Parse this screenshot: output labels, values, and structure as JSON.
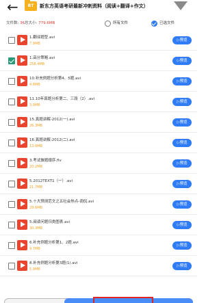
{
  "header": {
    "back_glyph": "←",
    "folder_badge": "BT",
    "title": "新东方英语考研最新冲刺资料（阅读+翻译+作文）"
  },
  "info": {
    "count_label": "文件数:",
    "count": "36",
    "size_label": "总大小:",
    "size": "779.6MB",
    "option_all": "所有文件",
    "option_selected": "已选文件"
  },
  "files": [
    {
      "name": "1.翻译题型.avi",
      "size": "7.9MB",
      "checked": false
    },
    {
      "name": "1.高分策略.avi",
      "size": "258.4MB",
      "checked": true
    },
    {
      "name": "10.补充例题分析第4、5题.avi",
      "size": "4.8MB",
      "checked": false
    },
    {
      "name": "11.10年真题分析第二、三段（2）.avi",
      "size": "3.0MB",
      "checked": false
    },
    {
      "name": "15.真题讲解-2012(一).avi",
      "size": "26.3MB",
      "checked": false
    },
    {
      "name": "16.真题讲解-2012(二).avi",
      "size": "13.6MB",
      "checked": false
    },
    {
      "name": "3.考试做题顺序.flv",
      "size": "20.2MB",
      "checked": false
    },
    {
      "name": "5.2012TEXT1（一）.avi",
      "size": "21.7MB",
      "checked": false
    },
    {
      "name": "5.十大预测范文之五社会热点-调侃.avi",
      "size": "29.6MB",
      "checked": false
    },
    {
      "name": "5.阅读问题归类图表.avi",
      "size": "30.3MB",
      "checked": false
    },
    {
      "name": "6.补充例题分析第1、2题.avi",
      "size": "9.7MB",
      "checked": false
    },
    {
      "name": "8.补充例题分析第3题(1).avi",
      "size": "5.9MB",
      "checked": false
    }
  ],
  "preview_label": "预览",
  "preview_glyph": "▷",
  "colors": {
    "accent": "#2f7cf6",
    "checked": "#2c9a7a",
    "video_icon": "#e8442e",
    "size_text": "#f0a020",
    "count_text": "#e53935",
    "highlight_box": "#e0241f"
  }
}
